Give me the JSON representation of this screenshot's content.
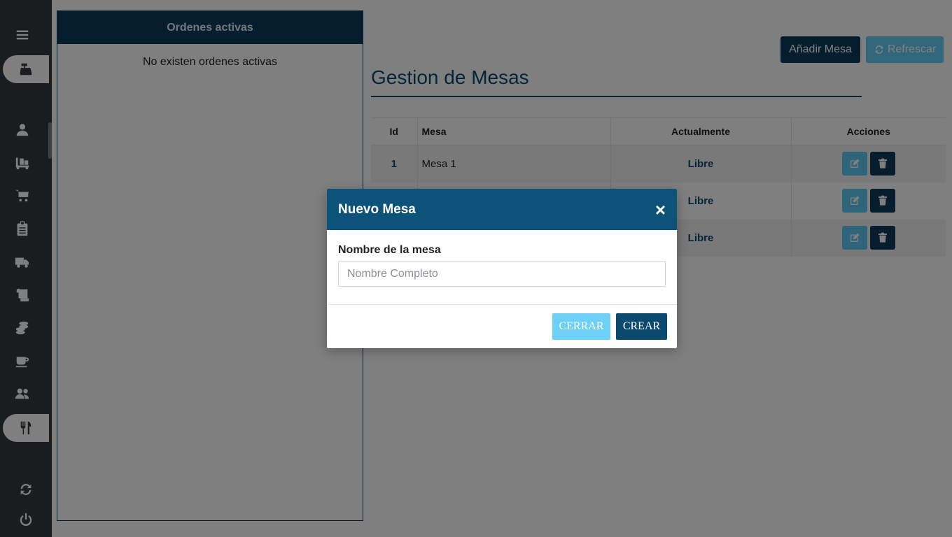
{
  "sidebar": {
    "items": [
      {
        "name": "menu-icon"
      },
      {
        "name": "cash-register-icon",
        "active": true
      },
      {
        "name": "user-icon"
      },
      {
        "name": "dolly-icon"
      },
      {
        "name": "cart-icon"
      },
      {
        "name": "clipboard-icon"
      },
      {
        "name": "truck-icon"
      },
      {
        "name": "scroll-icon"
      },
      {
        "name": "coins-icon"
      },
      {
        "name": "coffee-icon"
      },
      {
        "name": "users-icon"
      },
      {
        "name": "utensils-icon",
        "active": true
      },
      {
        "name": "sync-icon"
      },
      {
        "name": "power-icon"
      }
    ]
  },
  "orders": {
    "title": "Ordenes activas",
    "empty_text": "No existen ordenes activas"
  },
  "toolbar": {
    "add_label": "Añadir Mesa",
    "refresh_label": "Refrescar"
  },
  "page_title": "Gestion de Mesas",
  "table": {
    "headers": [
      "Id",
      "Mesa",
      "Actualmente",
      "Acciones"
    ],
    "rows": [
      {
        "id": "1",
        "mesa": "Mesa 1",
        "status": "Libre"
      },
      {
        "id": "",
        "mesa": "",
        "status": "Libre"
      },
      {
        "id": "",
        "mesa": "",
        "status": "Libre"
      }
    ]
  },
  "modal": {
    "title": "Nuevo Mesa",
    "close": "×",
    "field_label": "Nombre de la mesa",
    "field_placeholder": "Nombre Completo",
    "cancel_label": "CERRAR",
    "confirm_label": "CREAR"
  },
  "colors": {
    "sidebar": "#343a40",
    "primary": "#0b3a5b",
    "info": "#5ccbf5"
  }
}
